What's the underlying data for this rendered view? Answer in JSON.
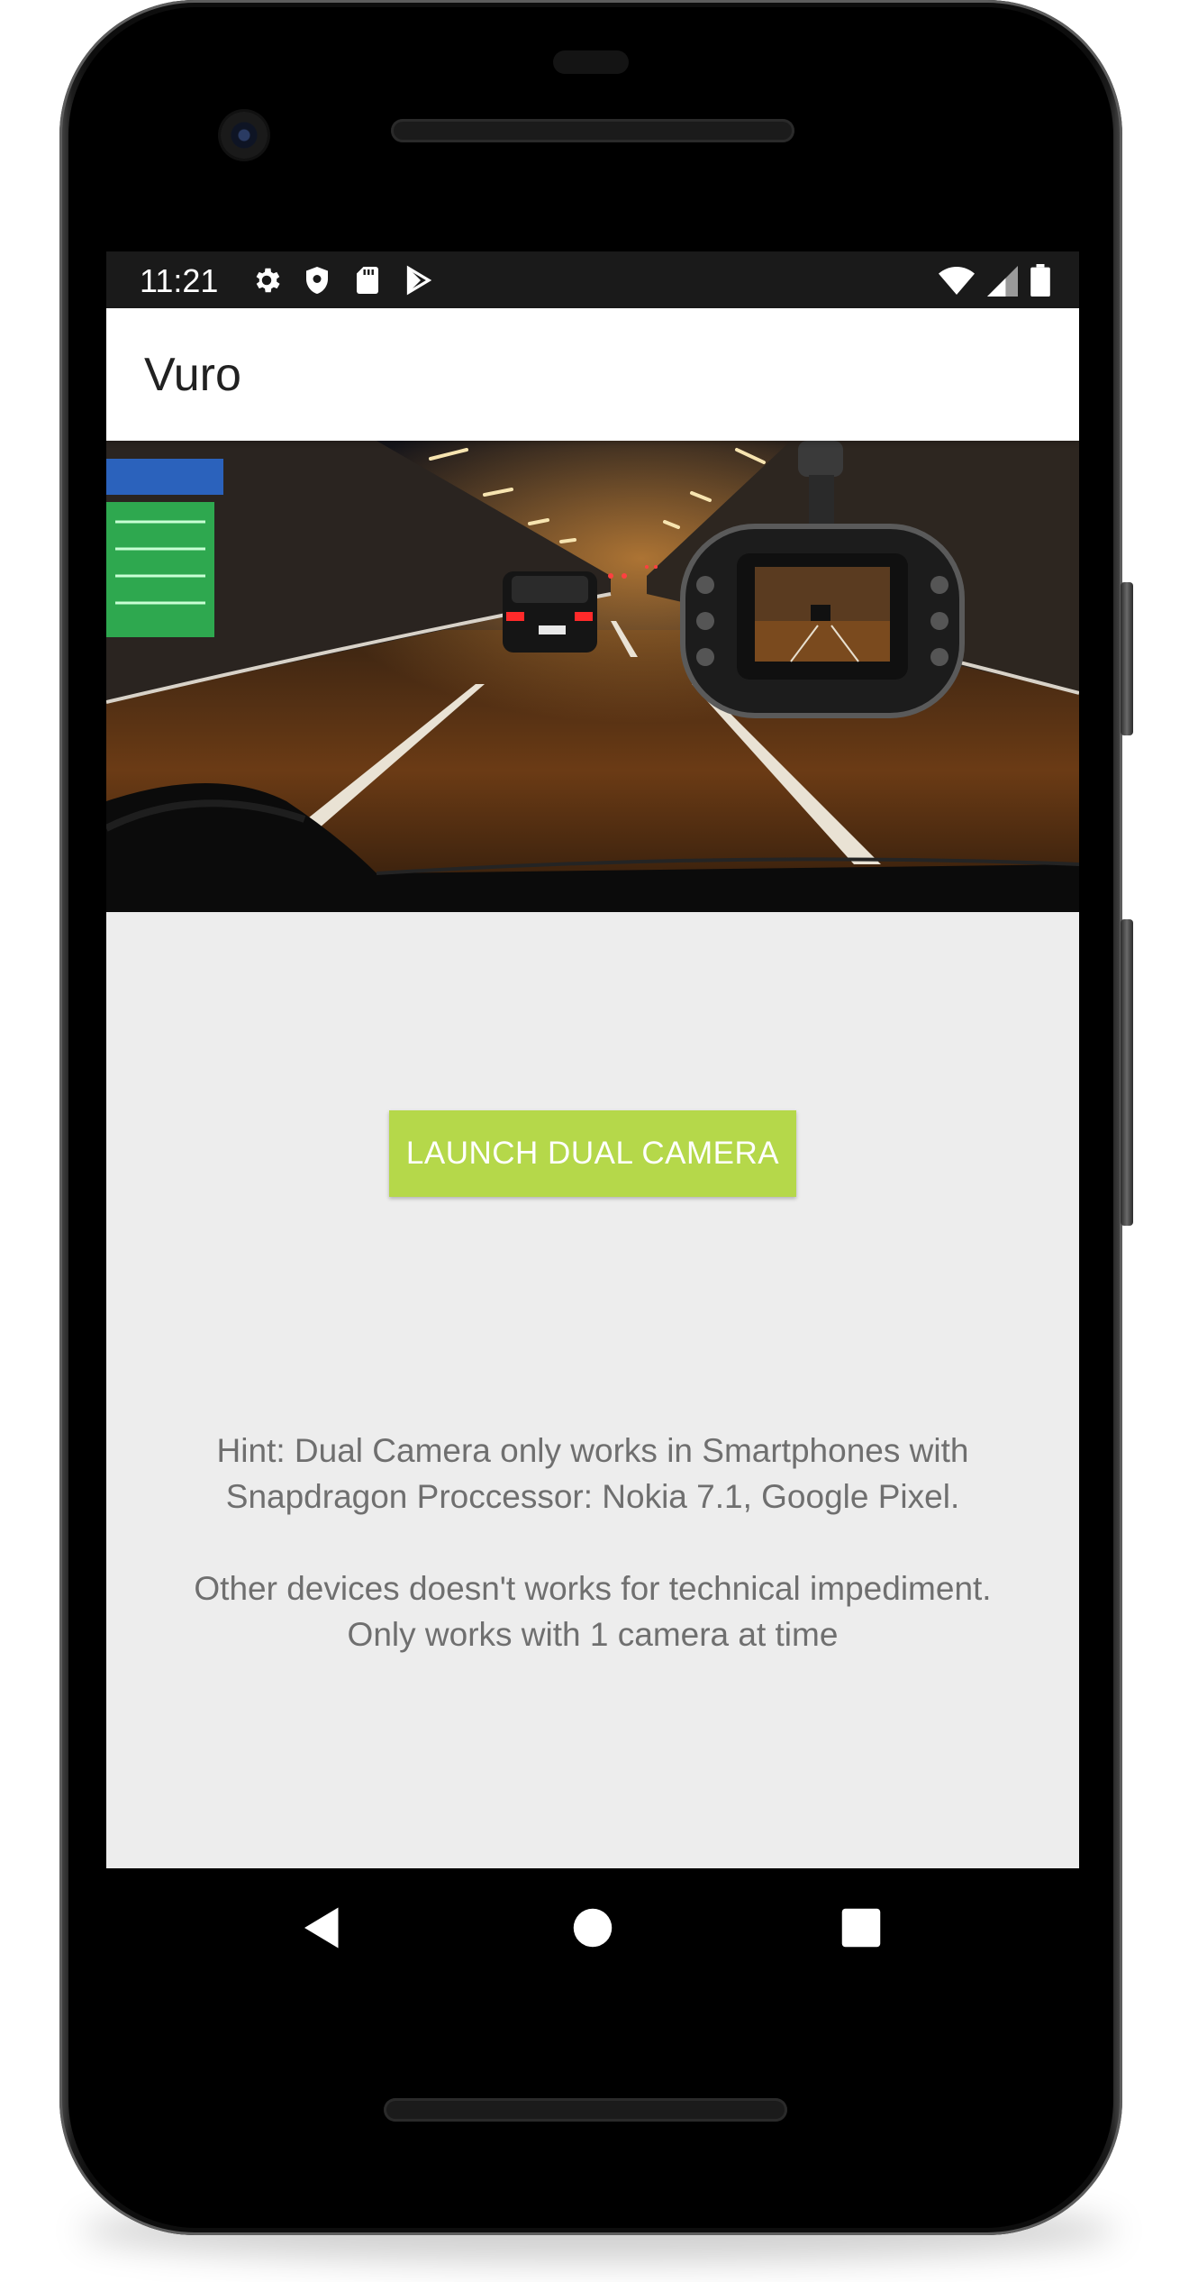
{
  "status_bar": {
    "time": "11:21",
    "left_icons": [
      "settings-icon",
      "shield-icon",
      "sd-card-icon",
      "play-store-icon"
    ],
    "right_icons": [
      "wifi-icon",
      "cell-signal-icon",
      "battery-icon"
    ]
  },
  "app_bar": {
    "title": "Vuro"
  },
  "hero_image": {
    "description_icon": "dashcam-road-photo"
  },
  "main": {
    "launch_button_label": "LAUNCH DUAL CAMERA",
    "hint_line_1": "Hint: Dual Camera only works in Smartphones with",
    "hint_line_2": "Snapdragon Proccessor: Nokia 7.1, Google Pixel.",
    "hint_line_3": "Other devices doesn't works for technical impediment.",
    "hint_line_4": "Only works with 1 camera at time"
  },
  "nav_bar": {
    "buttons": [
      "back-icon",
      "home-icon",
      "recents-icon"
    ]
  },
  "colors": {
    "accent_button": "#b5d84a",
    "content_background": "#ededed",
    "status_bar": "#1a1a1a",
    "hint_text": "#6f6f6f"
  }
}
